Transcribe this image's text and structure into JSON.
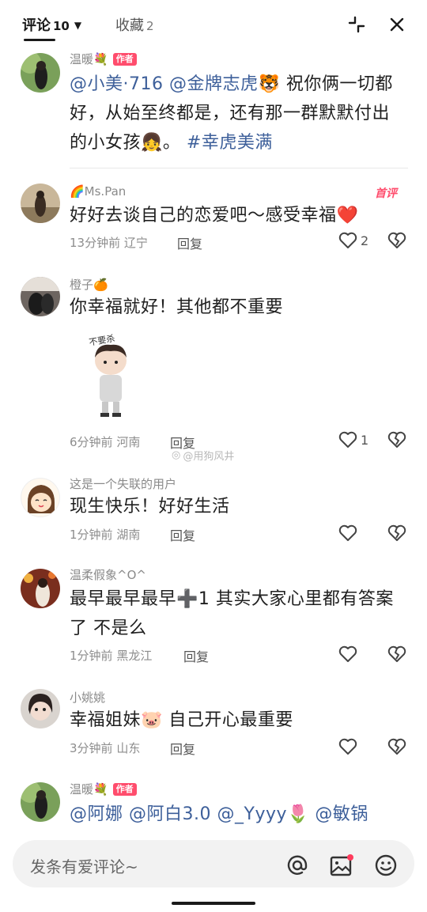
{
  "header": {
    "tab_comments": "评论",
    "comments_count": "10",
    "tab_favorites": "收藏",
    "favorites_count": "2"
  },
  "comments": [
    {
      "username": "温暖💐",
      "badge": "作者",
      "mention1": "@小美·716",
      "mention2": "@金牌志虎🐯",
      "text": " 祝你俩一切都好，从始至终都是，还有那一群默默付出的小女孩👧。",
      "hashtag": "#幸虎美满"
    },
    {
      "username": "🌈Ms.Pan",
      "first_badge": "首评",
      "text": "好好去谈自己的恋爱吧～感受幸福❤️",
      "time": "13分钟前",
      "location": "辽宁",
      "reply": "回复",
      "likes": "2"
    },
    {
      "username": "橙子🍊",
      "text": "你幸福就好！其他都不重要",
      "sticker_text": "不要杀",
      "time": "6分钟前",
      "location": "河南",
      "reply": "回复",
      "likes": "1"
    },
    {
      "username": "这是一个失联的用户",
      "text": "现生快乐！好好生活",
      "time": "1分钟前",
      "location": "湖南",
      "reply": "回复"
    },
    {
      "username": "温柔假象^O^",
      "text": "最早最早最早➕1   其实大家心里都有答案了 不是么",
      "time": "1分钟前",
      "location": "黑龙江",
      "reply": "回复"
    },
    {
      "username": "小姚姚",
      "text": "幸福姐妹🐷 自己开心最重要",
      "time": "3分钟前",
      "location": "山东",
      "reply": "回复"
    },
    {
      "username": "温暖💐",
      "badge": "作者",
      "mention1": "@阿娜",
      "mention2": "@阿白3.0",
      "mention3": "@_Yyyy🌷",
      "mention4": "@敏锅"
    }
  ],
  "watermark": "@用狗风井",
  "input": {
    "placeholder": "发条有爱评论~"
  },
  "colors": {
    "mention": "#3d5f9a",
    "badge": "#ff4d6d",
    "meta": "#8d8d8d"
  },
  "icons": [
    "chevron-down-icon",
    "collapse-icon",
    "close-icon",
    "heart-icon",
    "broken-heart-icon",
    "at-icon",
    "image-icon",
    "emoji-icon"
  ]
}
